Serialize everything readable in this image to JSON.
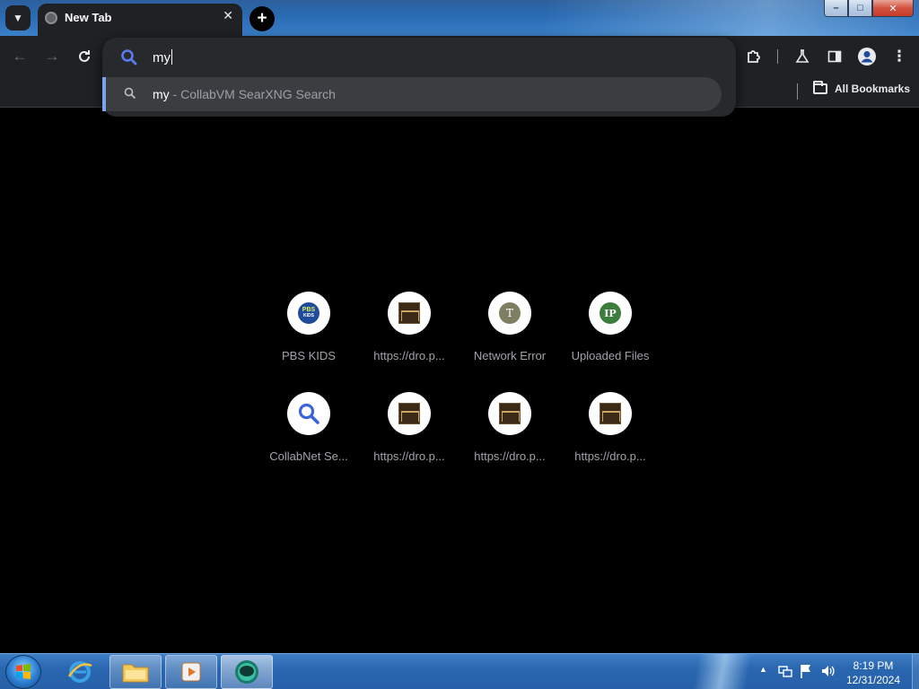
{
  "browser": {
    "tab": {
      "title": "New Tab"
    },
    "window_controls": {
      "minimize": "–",
      "maximize": "□",
      "close": "✕"
    }
  },
  "omnibox": {
    "query": "my",
    "suggestion": {
      "query": "my",
      "engine": " - CollabVM SearXNG Search"
    }
  },
  "bookmarks_bar": {
    "all_bookmarks_label": "All Bookmarks"
  },
  "shortcuts": [
    {
      "label": "PBS KIDS",
      "icon": "pbs-kids-icon"
    },
    {
      "label": "https://dro.p...",
      "icon": "site-thumbnail-icon"
    },
    {
      "label": "Network Error",
      "icon": "letter-t-icon",
      "letter": "T"
    },
    {
      "label": "Uploaded Files",
      "icon": "letter-ip-icon",
      "letter": "IP"
    },
    {
      "label": "CollabNet Se...",
      "icon": "search-icon"
    },
    {
      "label": "https://dro.p...",
      "icon": "site-thumbnail-icon"
    },
    {
      "label": "https://dro.p...",
      "icon": "site-thumbnail-icon"
    },
    {
      "label": "https://dro.p...",
      "icon": "site-thumbnail-icon"
    }
  ],
  "taskbar": {
    "clock_time": "8:19 PM",
    "clock_date": "12/31/2024"
  },
  "colors": {
    "toolbar_bg": "#1f2124",
    "omnibox_bg": "#28292c",
    "suggestion_accent": "#7ca3f0",
    "search_blue": "#5b7cf0",
    "taskbar_blue": "#2a67b0"
  }
}
